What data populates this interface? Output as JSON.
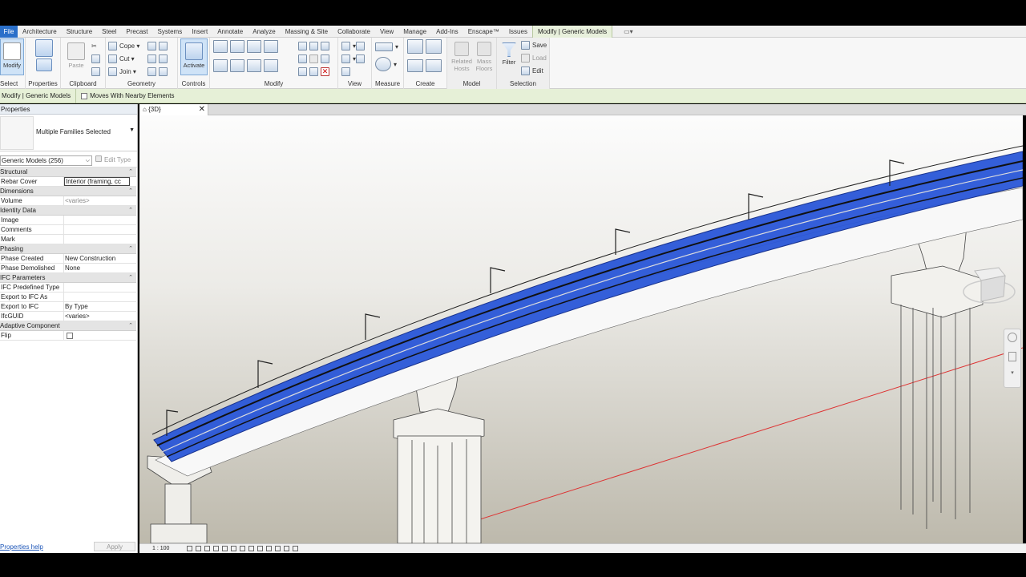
{
  "tabs": [
    "File",
    "Architecture",
    "Structure",
    "Steel",
    "Precast",
    "Systems",
    "Insert",
    "Annotate",
    "Analyze",
    "Massing & Site",
    "Collaborate",
    "View",
    "Manage",
    "Add-Ins",
    "Enscape™",
    "Issues",
    "Modify | Generic Models"
  ],
  "ribbon": {
    "select": {
      "button": "Modify",
      "label": "Select"
    },
    "properties": {
      "label": "Properties"
    },
    "clipboard": {
      "paste": "Paste",
      "label": "Clipboard"
    },
    "geometry": {
      "cope": "Cope",
      "cut": "Cut",
      "join": "Join",
      "label": "Geometry"
    },
    "controls": {
      "button": "Activate",
      "label": "Controls"
    },
    "modify": {
      "label": "Modify"
    },
    "view": {
      "label": "View"
    },
    "measure": {
      "label": "Measure"
    },
    "create": {
      "label": "Create"
    },
    "model": {
      "related_hosts": "Related Hosts",
      "mass_floors": "Mass Floors",
      "label": "Model"
    },
    "selection": {
      "filter": "Filter",
      "save": "Save",
      "load": "Load",
      "edit": "Edit",
      "label": "Selection"
    }
  },
  "options_bar": {
    "context": "Modify | Generic Models",
    "moves_with": "Moves With Nearby Elements"
  },
  "properties": {
    "title": "Properties",
    "type_name": "Multiple Families Selected",
    "filter": "Generic Models (256)",
    "edit_type": "Edit Type",
    "groups": [
      {
        "name": "Structural",
        "rows": [
          {
            "k": "Rebar Cover",
            "v": "Interior (framing, cc"
          }
        ]
      },
      {
        "name": "Dimensions",
        "rows": [
          {
            "k": "Volume",
            "v": "<varies>"
          }
        ]
      },
      {
        "name": "Identity Data",
        "rows": [
          {
            "k": "Image",
            "v": ""
          },
          {
            "k": "Comments",
            "v": ""
          },
          {
            "k": "Mark",
            "v": ""
          }
        ]
      },
      {
        "name": "Phasing",
        "rows": [
          {
            "k": "Phase Created",
            "v": "New Construction"
          },
          {
            "k": "Phase Demolished",
            "v": "None"
          }
        ]
      },
      {
        "name": "IFC Parameters",
        "rows": [
          {
            "k": "IFC Predefined Type",
            "v": ""
          },
          {
            "k": "Export to IFC As",
            "v": ""
          },
          {
            "k": "Export to IFC",
            "v": "By Type"
          },
          {
            "k": "IfcGUID",
            "v": "<varies>"
          }
        ]
      },
      {
        "name": "Adaptive Component",
        "rows": [
          {
            "k": "Flip",
            "v": ""
          }
        ]
      }
    ],
    "help": "Properties help",
    "apply": "Apply"
  },
  "view": {
    "tab": "{3D}",
    "scale": "1 : 100"
  },
  "colors": {
    "file_tab": "#2a6fc9",
    "selection": "#1f4fd6",
    "context_bar": "#e6f0d7"
  }
}
